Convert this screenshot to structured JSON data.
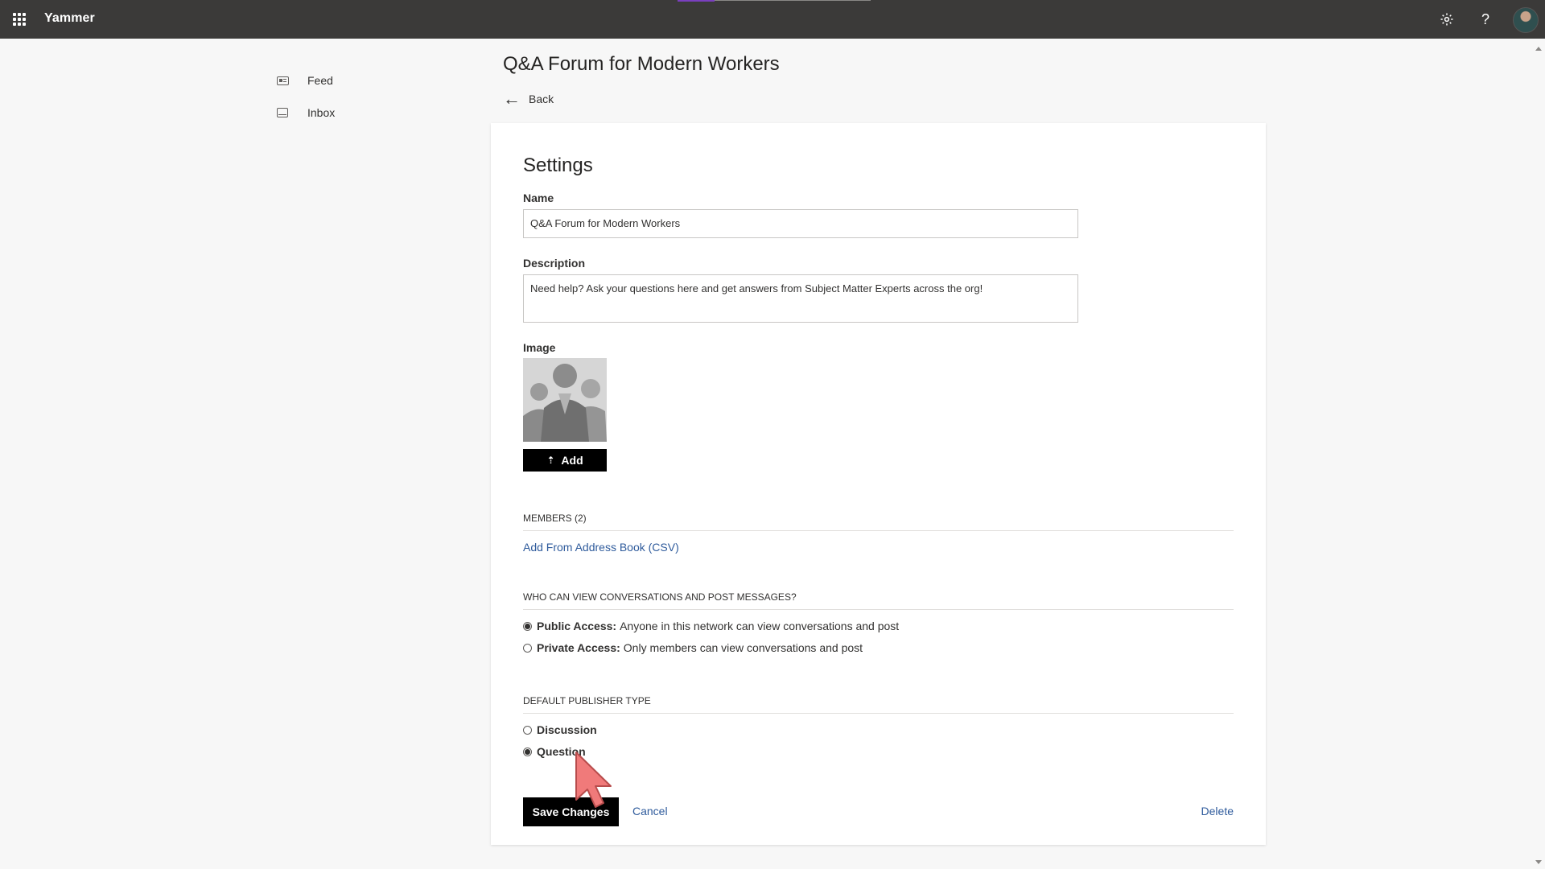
{
  "app": {
    "title": "Yammer"
  },
  "colors": {
    "topbar": "#3b3a39",
    "link": "#2f5b9c",
    "button": "#000000"
  },
  "icons": {
    "waffle": "app-launcher-icon",
    "settings": "gear-icon",
    "help": "question-mark-icon",
    "profile": "avatar"
  },
  "topbar": {
    "help_glyph": "?"
  },
  "nav": {
    "items": [
      {
        "label": "Feed",
        "icon": "feed-icon"
      },
      {
        "label": "Inbox",
        "icon": "inbox-icon"
      }
    ]
  },
  "header": {
    "group_title": "Q&A Forum for Modern Workers",
    "back_label": "Back"
  },
  "settings": {
    "heading": "Settings",
    "name_label": "Name",
    "name_value": "Q&A Forum for Modern Workers",
    "description_label": "Description",
    "description_value": "Need help? Ask your questions here and get answers from Subject Matter Experts across the org!",
    "image_label": "Image",
    "add_label": "Add",
    "members_heading": "MEMBERS (2)",
    "add_from_address_book": "Add From Address Book (CSV)",
    "access_heading": "WHO CAN VIEW CONVERSATIONS AND POST MESSAGES?",
    "access_options": [
      {
        "title": "Public Access:",
        "desc": "Anyone in this network can view conversations and post",
        "selected": true
      },
      {
        "title": "Private Access:",
        "desc": "Only members can view conversations and post",
        "selected": false
      }
    ],
    "publisher_heading": "DEFAULT PUBLISHER TYPE",
    "publisher_options": [
      {
        "label": "Discussion",
        "selected": false
      },
      {
        "label": "Question",
        "selected": true
      }
    ],
    "save_label": "Save Changes",
    "cancel_label": "Cancel",
    "delete_label": "Delete"
  }
}
